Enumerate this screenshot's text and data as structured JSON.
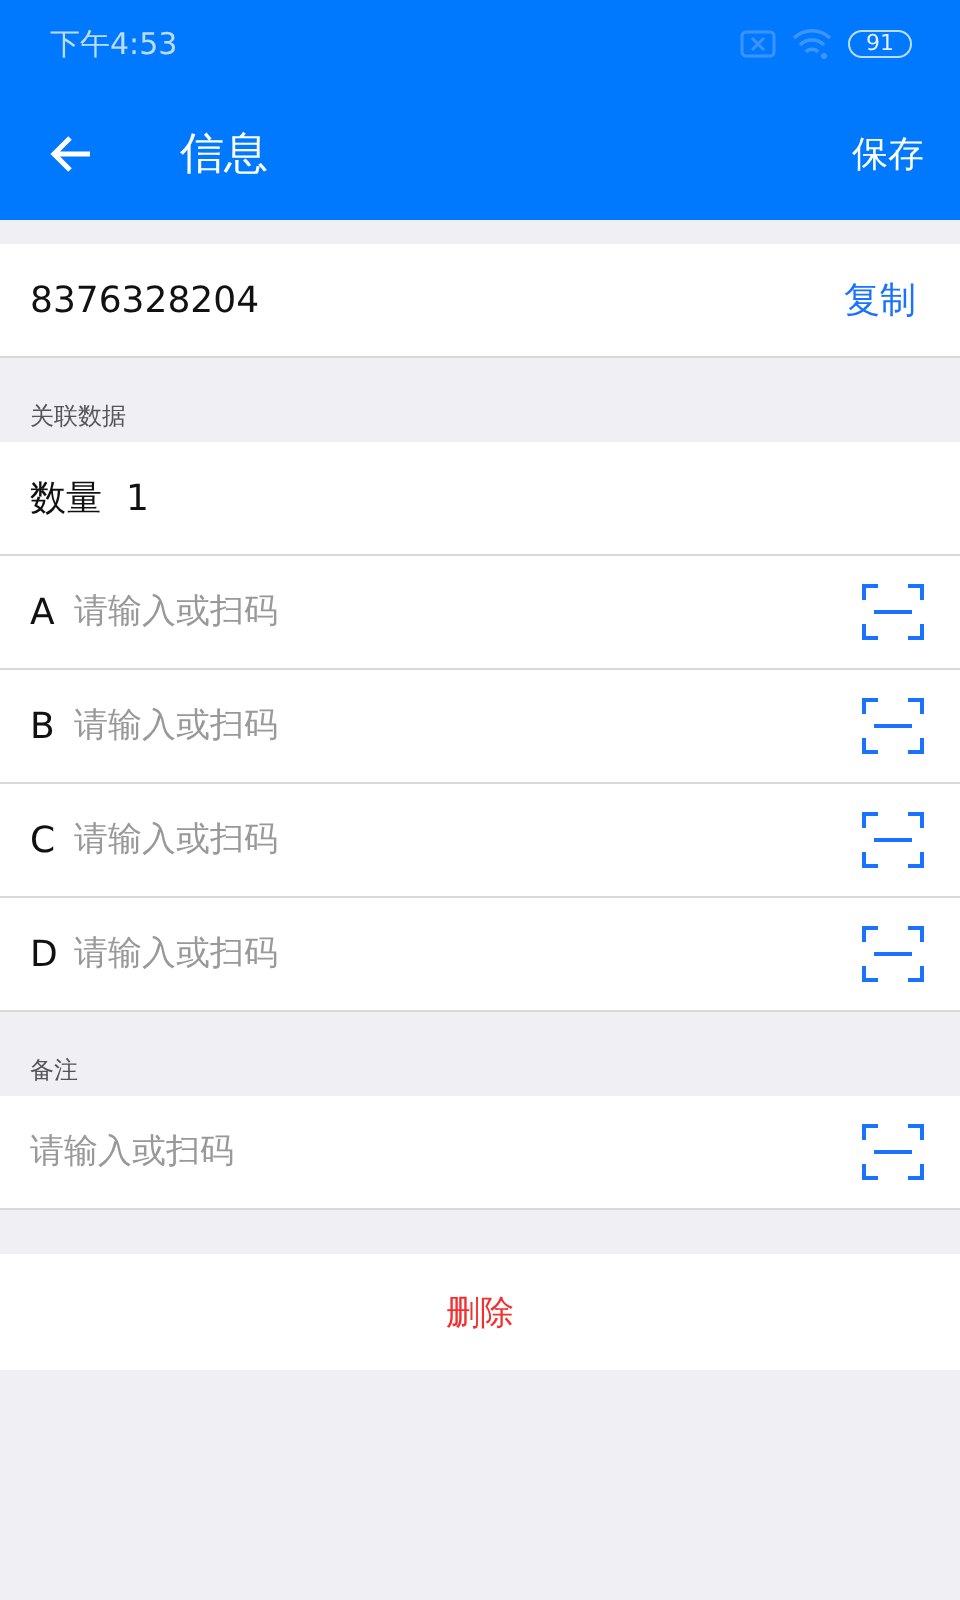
{
  "status_bar": {
    "time": "下午4:53",
    "battery": "91"
  },
  "toolbar": {
    "title": "信息",
    "action": "保存"
  },
  "code": {
    "value": "8376328204",
    "action": "复制"
  },
  "related": {
    "heading": "关联数据",
    "quantity_label": "数量",
    "quantity": "1",
    "fields": [
      {
        "label": "A",
        "placeholder": "请输入或扫码"
      },
      {
        "label": "B",
        "placeholder": "请输入或扫码"
      },
      {
        "label": "C",
        "placeholder": "请输入或扫码"
      },
      {
        "label": "D",
        "placeholder": "请输入或扫码"
      }
    ]
  },
  "note": {
    "heading": "备注",
    "placeholder": "请输入或扫码"
  },
  "delete_button": "删除"
}
